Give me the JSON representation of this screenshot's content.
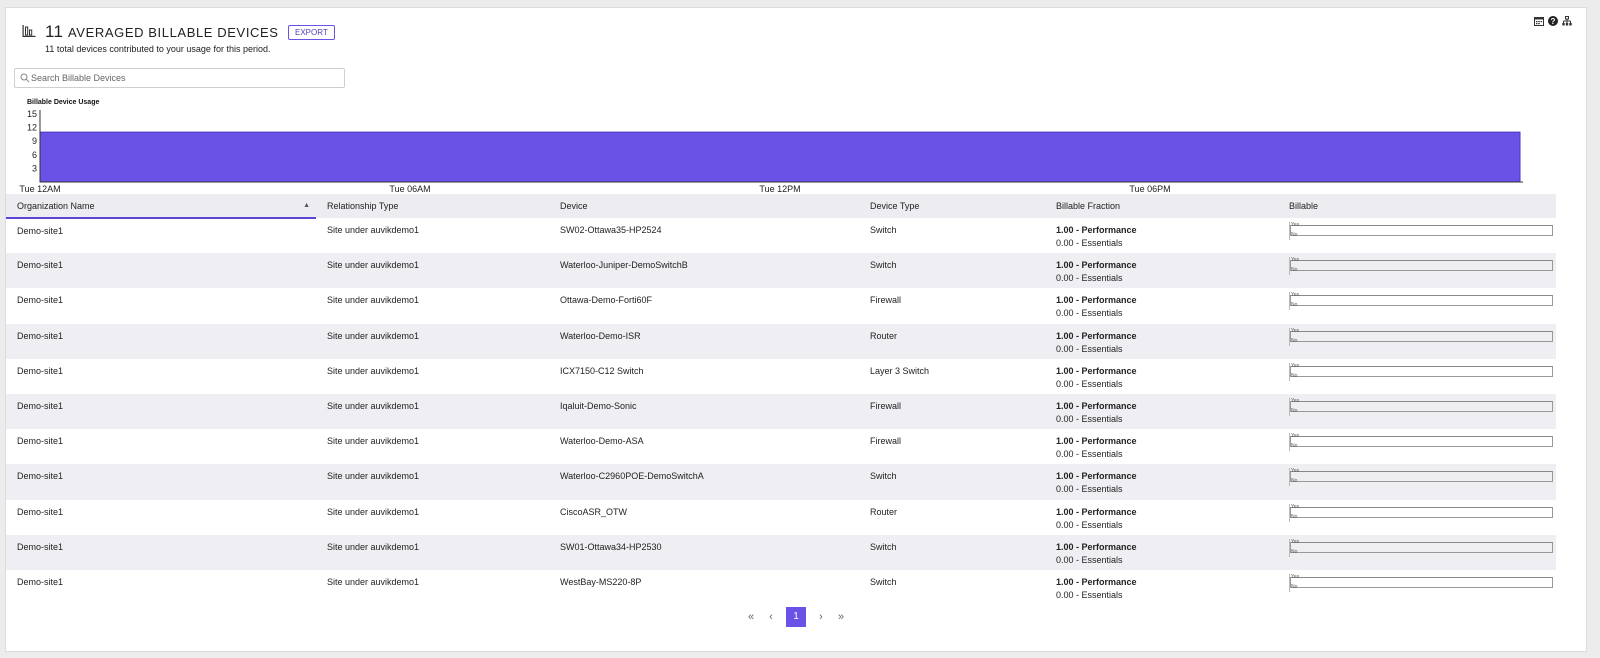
{
  "header": {
    "count": "11",
    "title": "Averaged Billable Devices",
    "export_label": "EXPORT",
    "subtitle": "11 total devices contributed to your usage for this period."
  },
  "search": {
    "placeholder": "Search Billable Devices"
  },
  "chart_data": {
    "type": "area",
    "title": "Billable Device Usage",
    "x_ticks": [
      "Tue 12AM",
      "Tue 06AM",
      "Tue 12PM",
      "Tue 06PM"
    ],
    "y_ticks": [
      "15",
      "12",
      "9",
      "6",
      "3"
    ],
    "ylim": [
      0,
      15
    ],
    "series": [
      {
        "values": [
          11,
          11
        ]
      }
    ],
    "color": "#6b52e6"
  },
  "table": {
    "columns": [
      "Organization Name",
      "Relationship Type",
      "Device",
      "Device Type",
      "Billable Fraction",
      "Billable"
    ],
    "mini_labels": {
      "yes": "Yes",
      "no": "No"
    },
    "rows": [
      {
        "org": "Demo-site1",
        "rel": "Site under auvikdemo1",
        "device": "SW02-Ottawa35-HP2524",
        "type": "Switch",
        "perf": "1.00 - Performance",
        "ess": "0.00 - Essentials"
      },
      {
        "org": "Demo-site1",
        "rel": "Site under auvikdemo1",
        "device": "Waterloo-Juniper-DemoSwitchB",
        "type": "Switch",
        "perf": "1.00 - Performance",
        "ess": "0.00 - Essentials"
      },
      {
        "org": "Demo-site1",
        "rel": "Site under auvikdemo1",
        "device": "Ottawa-Demo-Forti60F",
        "type": "Firewall",
        "perf": "1.00 - Performance",
        "ess": "0.00 - Essentials"
      },
      {
        "org": "Demo-site1",
        "rel": "Site under auvikdemo1",
        "device": "Waterloo-Demo-ISR",
        "type": "Router",
        "perf": "1.00 - Performance",
        "ess": "0.00 - Essentials"
      },
      {
        "org": "Demo-site1",
        "rel": "Site under auvikdemo1",
        "device": "ICX7150-C12 Switch",
        "type": "Layer 3 Switch",
        "perf": "1.00 - Performance",
        "ess": "0.00 - Essentials"
      },
      {
        "org": "Demo-site1",
        "rel": "Site under auvikdemo1",
        "device": "Iqaluit-Demo-Sonic",
        "type": "Firewall",
        "perf": "1.00 - Performance",
        "ess": "0.00 - Essentials"
      },
      {
        "org": "Demo-site1",
        "rel": "Site under auvikdemo1",
        "device": "Waterloo-Demo-ASA",
        "type": "Firewall",
        "perf": "1.00 - Performance",
        "ess": "0.00 - Essentials"
      },
      {
        "org": "Demo-site1",
        "rel": "Site under auvikdemo1",
        "device": "Waterloo-C2960POE-DemoSwitchA",
        "type": "Switch",
        "perf": "1.00 - Performance",
        "ess": "0.00 - Essentials"
      },
      {
        "org": "Demo-site1",
        "rel": "Site under auvikdemo1",
        "device": "CiscoASR_OTW",
        "type": "Router",
        "perf": "1.00 - Performance",
        "ess": "0.00 - Essentials"
      },
      {
        "org": "Demo-site1",
        "rel": "Site under auvikdemo1",
        "device": "SW01-Ottawa34-HP2530",
        "type": "Switch",
        "perf": "1.00 - Performance",
        "ess": "0.00 - Essentials"
      },
      {
        "org": "Demo-site1",
        "rel": "Site under auvikdemo1",
        "device": "WestBay-MS220-8P",
        "type": "Switch",
        "perf": "1.00 - Performance",
        "ess": "0.00 - Essentials"
      }
    ]
  },
  "pager": {
    "first": "«",
    "prev": "‹",
    "current": "1",
    "next": "›",
    "last": "»"
  }
}
